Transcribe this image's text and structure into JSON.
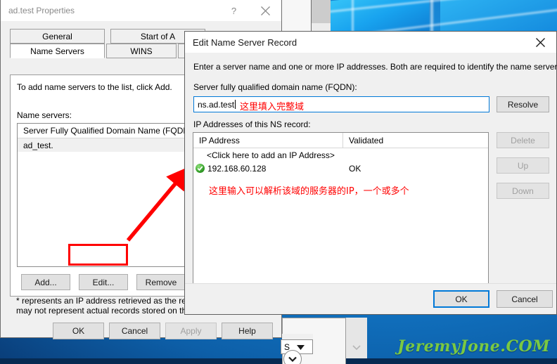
{
  "desktop": {
    "watermark": "JeremyJone.COM",
    "wallpaper_color": "#1279c9",
    "watermark_color": "#7ac943"
  },
  "properties_window": {
    "title": "ad.test Properties",
    "help_icon": "?",
    "close_icon": "close-icon",
    "tabs_row1": [
      "General",
      "Start of A"
    ],
    "tabs_row2": [
      "Name Servers",
      "WINS"
    ],
    "active_tab": "Name Servers",
    "instruction": "To add name servers to the list, click Add.",
    "list_label": "Name servers:",
    "list_header": "Server Fully Qualified Domain Name (FQDN)",
    "list_rows": [
      "ad_test."
    ],
    "buttons": [
      {
        "label": "Add...",
        "enabled": true
      },
      {
        "label": "Edit...",
        "enabled": true,
        "highlighted": true
      },
      {
        "label": "Remove",
        "enabled": true
      }
    ],
    "footnote_line1": "* represents an IP address retrieved as the result",
    "footnote_line2": "may not represent actual records stored on this se",
    "dialog_buttons": [
      {
        "label": "OK",
        "enabled": true
      },
      {
        "label": "Cancel",
        "enabled": true
      },
      {
        "label": "Apply",
        "enabled": false
      },
      {
        "label": "Help",
        "enabled": true
      }
    ]
  },
  "edit_dialog": {
    "title": "Edit Name Server Record",
    "close_icon": "close-icon",
    "description": "Enter a server name and one or more IP addresses.  Both are required to identify the name server.",
    "fqdn_label": "Server fully qualified domain name (FQDN):",
    "fqdn_value": "ns.ad.test",
    "fqdn_annotation": "这里填入完整域",
    "resolve_button": "Resolve",
    "ip_list_label": "IP Addresses of this NS record:",
    "ip_columns": [
      "IP Address",
      "Validated"
    ],
    "ip_add_row": "<Click here to add an IP Address>",
    "ip_rows": [
      {
        "address": "192.168.60.128",
        "validated": "OK",
        "status_icon": "check-circle-icon"
      }
    ],
    "ip_annotation": "这里输入可以解析该域的服务器的IP，一个或多个",
    "side_buttons": [
      {
        "label": "Delete",
        "enabled": false
      },
      {
        "label": "Up",
        "enabled": false
      },
      {
        "label": "Down",
        "enabled": false
      }
    ],
    "dialog_buttons": [
      {
        "label": "OK",
        "enabled": true,
        "default": true
      },
      {
        "label": "Cancel",
        "enabled": true
      }
    ]
  },
  "background_window": {
    "combo_value": "S",
    "combo_icon": "chevron-down-icon",
    "scroll_icon": "chevron-down-circle-icon"
  },
  "annotations": {
    "arrow_color": "#ff0000",
    "highlight_color": "#ff0000"
  }
}
